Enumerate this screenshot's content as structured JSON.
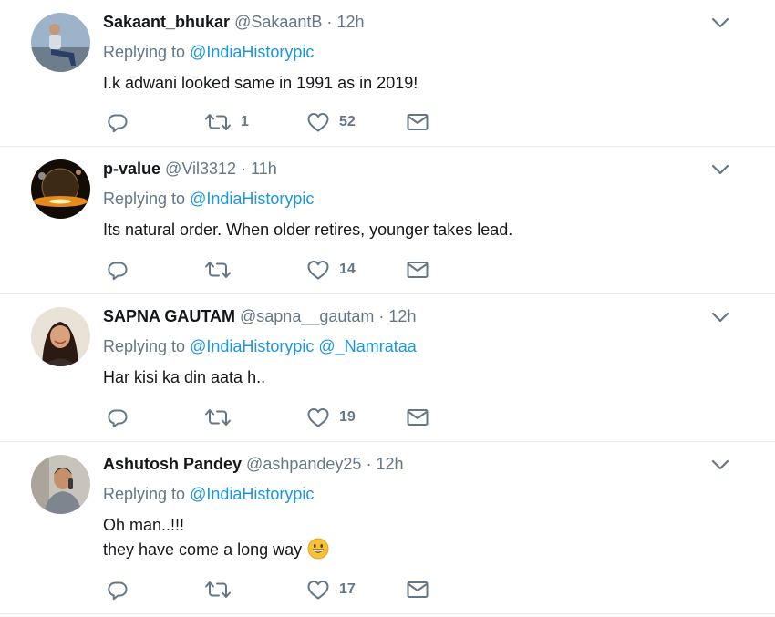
{
  "tweets": [
    {
      "name": "Sakaant_bhukar",
      "handle": "@SakaantB",
      "time": "12h",
      "replying_prefix": "Replying to",
      "replying_to": [
        "@IndiaHistorypic"
      ],
      "text_lines": [
        "I.k adwani looked same in 1991 as in 2019!"
      ],
      "emoji": "",
      "replies": "",
      "retweets": "1",
      "likes": "52",
      "avatar_desc": "person-sitting-outdoors"
    },
    {
      "name": "p-value",
      "handle": "@Vil3312",
      "time": "11h",
      "replying_prefix": "Replying to",
      "replying_to": [
        "@IndiaHistorypic"
      ],
      "text_lines": [
        "Its natural order. When older retires, younger takes lead."
      ],
      "emoji": "",
      "replies": "",
      "retweets": "",
      "likes": "14",
      "avatar_desc": "planet-sunrise"
    },
    {
      "name": "SAPNA GAUTAM",
      "handle": "@sapna__gautam",
      "time": "12h",
      "replying_prefix": "Replying to",
      "replying_to": [
        "@IndiaHistorypic",
        "@_Namrataa"
      ],
      "text_lines": [
        "Har kisi ka din aata h.."
      ],
      "emoji": "",
      "replies": "",
      "retweets": "",
      "likes": "19",
      "avatar_desc": "woman-portrait"
    },
    {
      "name": "Ashutosh Pandey",
      "handle": "@ashpandey25",
      "time": "12h",
      "replying_prefix": "Replying to",
      "replying_to": [
        "@IndiaHistorypic"
      ],
      "text_lines": [
        "Oh man..!!!",
        "they have come a long way"
      ],
      "emoji": "grinning-face-emoji",
      "replies": "",
      "retweets": "",
      "likes": "17",
      "avatar_desc": "man-on-phone"
    }
  ],
  "dot_separator": "·",
  "colors": {
    "link": "#1b95e0",
    "secondary_text": "#657786",
    "primary_text": "#14171a",
    "divider": "#e6ecf0"
  },
  "icons": {
    "more": "chevron-down-icon",
    "reply": "reply-icon",
    "retweet": "retweet-icon",
    "like": "heart-icon",
    "dm": "envelope-icon"
  }
}
